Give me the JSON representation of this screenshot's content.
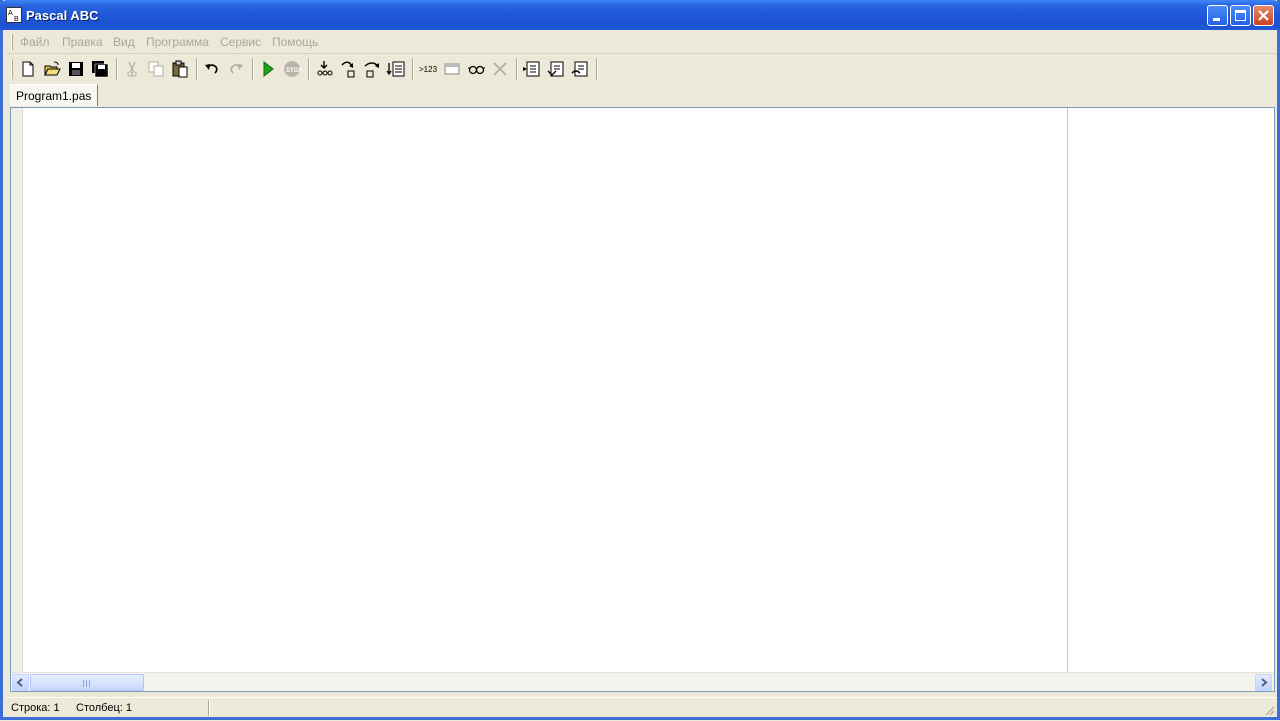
{
  "window": {
    "title": "Pascal ABC"
  },
  "menu": {
    "items": [
      {
        "label": "Файл"
      },
      {
        "label": "Правка"
      },
      {
        "label": "Вид"
      },
      {
        "label": "Программа"
      },
      {
        "label": "Сервис"
      },
      {
        "label": "Помощь"
      }
    ]
  },
  "toolbar": {
    "icons": [
      "new-file-icon",
      "open-file-icon",
      "save-icon",
      "save-all-icon",
      "cut-icon",
      "copy-icon",
      "paste-icon",
      "undo-icon",
      "redo-icon",
      "run-icon",
      "stop-icon",
      "step-into-icon",
      "step-over-icon",
      "step-out-icon",
      "run-to-cursor-icon",
      "evaluate-icon",
      "output-window-icon",
      "watch-icon",
      "clear-icon",
      "compile-icon",
      "build-icon",
      "rebuild-icon"
    ]
  },
  "tabs": [
    {
      "label": "Program1.pas"
    }
  ],
  "status": {
    "line": "Строка: 1",
    "column": "Столбец: 1"
  },
  "colors": {
    "titlebar": "#2159d6",
    "frame": "#3b6fd6",
    "chrome": "#ece9d8"
  }
}
